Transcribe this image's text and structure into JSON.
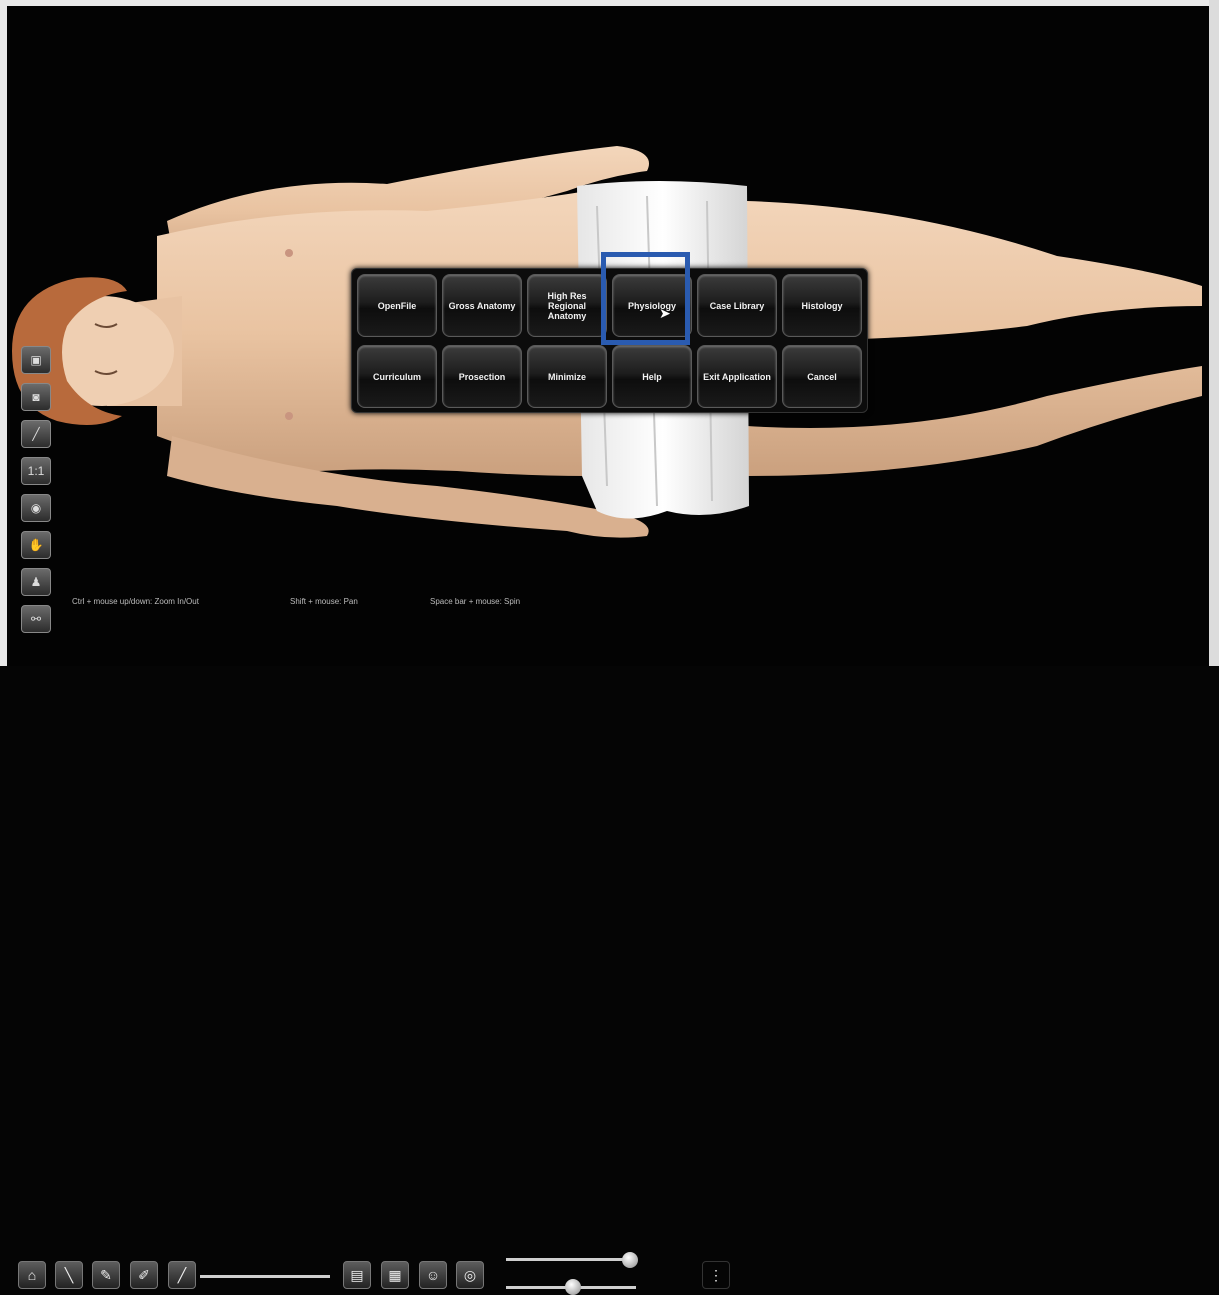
{
  "menu": {
    "row1": [
      "OpenFile",
      "Gross Anatomy",
      "High Res Regional Anatomy",
      "Physiology",
      "Case Library",
      "Histology"
    ],
    "row2": [
      "Curriculum",
      "Prosection",
      "Minimize",
      "Help",
      "Exit Application",
      "Cancel"
    ],
    "highlighted": "Physiology"
  },
  "hints": {
    "zoom": "Ctrl + mouse up/down: Zoom In/Out",
    "pan": "Shift + mouse: Pan",
    "spin": "Space bar + mouse: Spin"
  },
  "left_tools": [
    "view-icon",
    "camera-icon",
    "scalpel-icon",
    "scale-icon",
    "eye-icon",
    "hand-icon",
    "torso-icon",
    "link-icon"
  ],
  "left_tools_labels": {
    "scale": "1:1"
  },
  "bottom_tools": [
    "home-icon",
    "scalpel-icon",
    "pen-icon",
    "marker-icon",
    "slider-tool-icon",
    "folder-icon",
    "grid-icon",
    "person-icon",
    "eye-icon"
  ],
  "colors": {
    "highlight": "#2a5bb0",
    "background": "#030303"
  }
}
